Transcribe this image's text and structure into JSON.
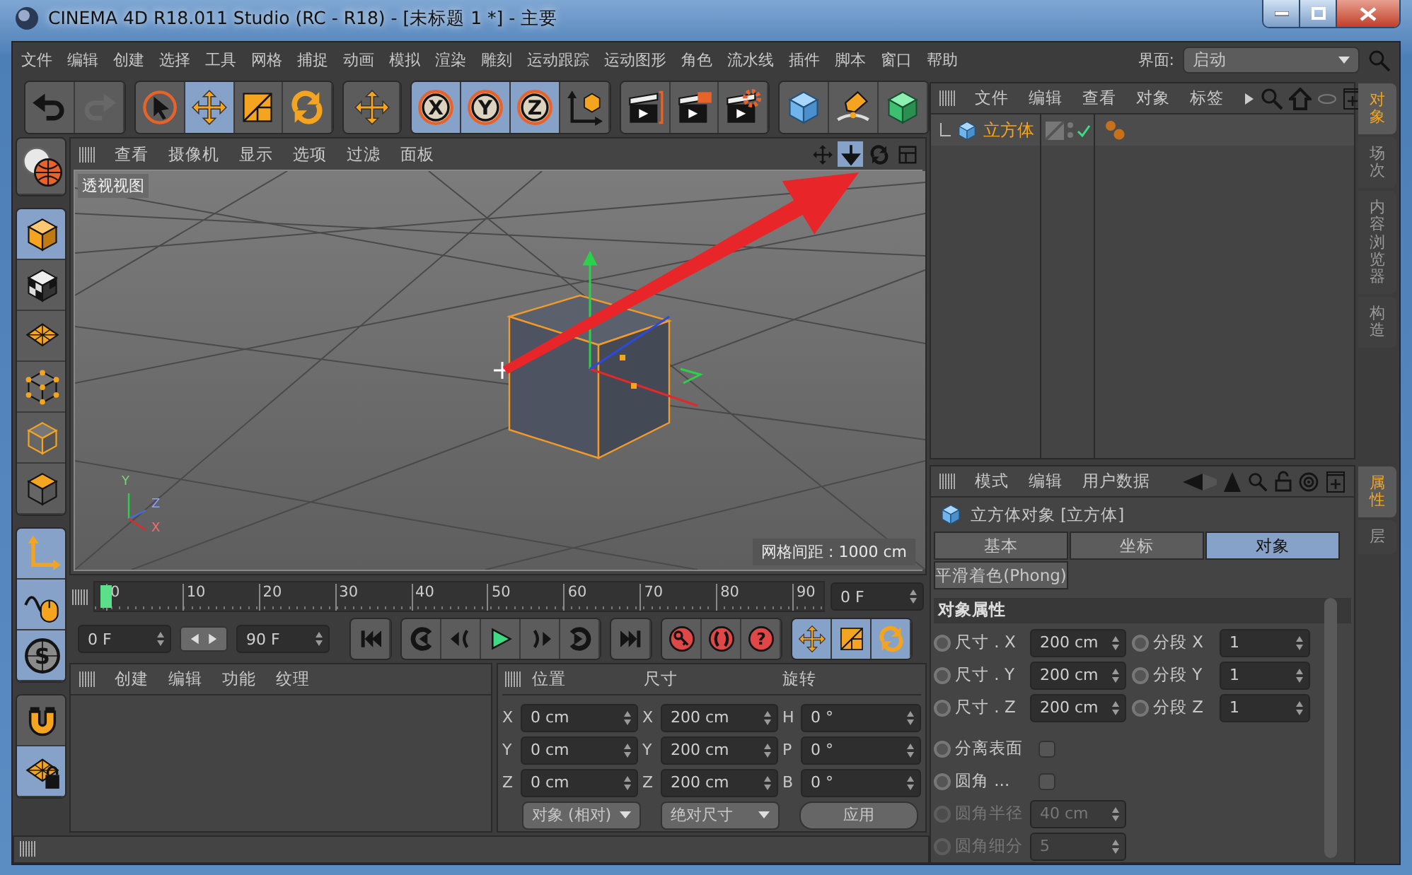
{
  "window": {
    "title": "CINEMA 4D R18.011 Studio (RC - R18) - [未标题 1 *] - 主要"
  },
  "menu": [
    "文件",
    "编辑",
    "创建",
    "选择",
    "工具",
    "网格",
    "捕捉",
    "动画",
    "模拟",
    "渲染",
    "雕刻",
    "运动跟踪",
    "运动图形",
    "角色",
    "流水线",
    "插件",
    "脚本",
    "窗口",
    "帮助"
  ],
  "layout_selector": {
    "label": "界面:",
    "value": "启动"
  },
  "toolbar": [
    {
      "items": [
        {
          "kind": "undo",
          "disabled": false
        },
        {
          "kind": "redo",
          "disabled": true
        }
      ]
    },
    {
      "items": [
        {
          "kind": "select",
          "selected": false
        },
        {
          "kind": "move",
          "selected": true
        },
        {
          "kind": "scale",
          "selected": false
        },
        {
          "kind": "rotate",
          "selected": false
        }
      ]
    },
    {
      "items": [
        {
          "kind": "move-all",
          "selected": false
        }
      ]
    },
    {
      "items": [
        {
          "kind": "axis-lock",
          "label": "X",
          "selected": true
        },
        {
          "kind": "axis-lock",
          "label": "Y",
          "selected": true
        },
        {
          "kind": "axis-lock",
          "label": "Z",
          "selected": true
        },
        {
          "kind": "coordinate-system",
          "selected": false
        }
      ]
    },
    {
      "items": [
        {
          "kind": "render-view"
        },
        {
          "kind": "render"
        },
        {
          "kind": "render-settings"
        }
      ]
    },
    {
      "items": [
        {
          "kind": "cube"
        },
        {
          "kind": "pen"
        },
        {
          "kind": "subdivision"
        }
      ]
    }
  ],
  "mode_tools": [
    {
      "items": [
        {
          "kind": "viewport-solo",
          "selected": false
        }
      ]
    },
    {
      "items": [
        {
          "kind": "model-mode",
          "selected": true
        },
        {
          "kind": "texture-mode",
          "selected": false
        },
        {
          "kind": "workplane",
          "selected": false
        },
        {
          "kind": "points-mode",
          "selected": false
        },
        {
          "kind": "edges-mode",
          "selected": false
        },
        {
          "kind": "polygons-mode",
          "selected": false
        }
      ]
    },
    {
      "items": [
        {
          "kind": "axis-mode",
          "selected": true
        },
        {
          "kind": "tweak-mode",
          "selected": true
        },
        {
          "kind": "snap",
          "label": "S",
          "selected": true
        }
      ]
    },
    {
      "items": [
        {
          "kind": "magnet",
          "selected": false
        },
        {
          "kind": "workplane-lock",
          "selected": true
        }
      ]
    }
  ],
  "viewport": {
    "menu": [
      "查看",
      "摄像机",
      "显示",
      "选项",
      "过滤",
      "面板"
    ],
    "nav_tools": [
      {
        "kind": "view-move",
        "selected": false
      },
      {
        "kind": "view-dolly",
        "selected": true
      },
      {
        "kind": "view-rotate",
        "selected": false
      },
      {
        "kind": "view-layout",
        "selected": false
      }
    ],
    "view_name": "透视视图",
    "grid_info": "网格间距 : 1000 cm",
    "axis_labels": [
      "Y",
      "Z",
      "X"
    ]
  },
  "timeline": {
    "ticks": [
      "0",
      "10",
      "20",
      "30",
      "40",
      "50",
      "60",
      "70",
      "80",
      "90"
    ],
    "level": 0,
    "current_frame": "0 F"
  },
  "transport": {
    "start": "0 F",
    "end": "90 F",
    "groups": [
      {
        "items": [
          {
            "kind": "skip-start"
          }
        ]
      },
      {
        "items": [
          {
            "kind": "previous-key"
          },
          {
            "kind": "previous-frame"
          },
          {
            "kind": "play"
          },
          {
            "kind": "next-frame"
          },
          {
            "kind": "next-key"
          }
        ]
      },
      {
        "items": [
          {
            "kind": "skip-end"
          }
        ]
      },
      {
        "items": [
          {
            "kind": "record-key"
          },
          {
            "kind": "auto-key"
          },
          {
            "kind": "help",
            "label": "?"
          }
        ]
      },
      {
        "items": [
          {
            "kind": "move",
            "selected": true
          },
          {
            "kind": "scale",
            "selected": true
          },
          {
            "kind": "rotate",
            "selected": true
          }
        ]
      }
    ]
  },
  "material_manager": {
    "menu": [
      "创建",
      "编辑",
      "功能",
      "纹理"
    ]
  },
  "coordinates": {
    "headers": [
      "位置",
      "尺寸",
      "旋转"
    ],
    "rows": [
      {
        "cells": [
          {
            "axis": "X",
            "value": "0 cm"
          },
          {
            "axis": "X",
            "value": "200 cm"
          },
          {
            "axis": "H",
            "value": "0 °"
          }
        ]
      },
      {
        "cells": [
          {
            "axis": "Y",
            "value": "0 cm"
          },
          {
            "axis": "Y",
            "value": "200 cm"
          },
          {
            "axis": "P",
            "value": "0 °"
          }
        ]
      },
      {
        "cells": [
          {
            "axis": "Z",
            "value": "0 cm"
          },
          {
            "axis": "Z",
            "value": "200 cm"
          },
          {
            "axis": "B",
            "value": "0 °"
          }
        ]
      }
    ],
    "mode": "对象 (相对)",
    "size_mode": "绝对尺寸",
    "apply": "应用"
  },
  "object_manager": {
    "menu": [
      "文件",
      "编辑",
      "查看",
      "对象",
      "标签"
    ],
    "objects": [
      {
        "name": "立方体",
        "selected": true
      }
    ]
  },
  "side_tabs_top": [
    {
      "label": "对象",
      "selected": true
    },
    {
      "label": "场次",
      "selected": false
    },
    {
      "label": "内容浏览器",
      "selected": false
    },
    {
      "label": "构造",
      "selected": false
    }
  ],
  "attributes": {
    "menu": [
      "模式",
      "编辑",
      "用户数据"
    ],
    "title": "立方体对象 [立方体]",
    "tabs": [
      {
        "label": "基本",
        "selected": false
      },
      {
        "label": "坐标",
        "selected": false
      },
      {
        "label": "对象",
        "selected": true
      },
      {
        "label": "平滑着色(Phong)",
        "selected": false
      }
    ],
    "section": "对象属性",
    "params": [
      {
        "fields": [
          {
            "kind": "number",
            "label": "尺寸 . X",
            "value": "200 cm",
            "disabled": false
          },
          {
            "kind": "number",
            "label": "分段 X",
            "value": "1",
            "disabled": false
          }
        ]
      },
      {
        "fields": [
          {
            "kind": "number",
            "label": "尺寸 . Y",
            "value": "200 cm",
            "disabled": false
          },
          {
            "kind": "number",
            "label": "分段 Y",
            "value": "1",
            "disabled": false
          }
        ]
      },
      {
        "fields": [
          {
            "kind": "number",
            "label": "尺寸 . Z",
            "value": "200 cm",
            "disabled": false
          },
          {
            "kind": "number",
            "label": "分段 Z",
            "value": "1",
            "disabled": false
          }
        ]
      },
      {
        "fields": [
          {
            "kind": "checkbox",
            "label": "分离表面",
            "checked": false,
            "disabled": false
          }
        ]
      },
      {
        "fields": [
          {
            "kind": "checkbox",
            "label": "圆角 ...",
            "checked": false,
            "disabled": false
          }
        ]
      },
      {
        "fields": [
          {
            "kind": "number",
            "label": "圆角半径",
            "value": "40 cm",
            "disabled": true
          }
        ]
      },
      {
        "fields": [
          {
            "kind": "number",
            "label": "圆角细分",
            "value": "5",
            "disabled": true
          }
        ]
      }
    ]
  },
  "side_tabs_bottom": [
    {
      "label": "属性",
      "selected": true
    },
    {
      "label": "层",
      "selected": false
    }
  ]
}
